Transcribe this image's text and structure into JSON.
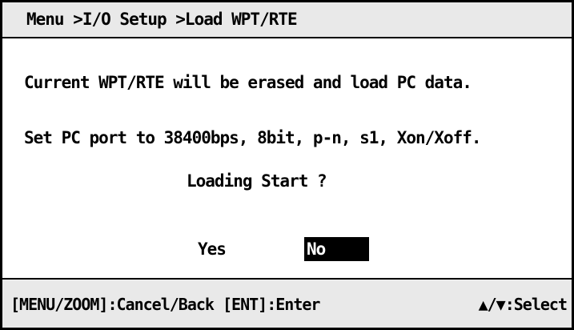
{
  "header": {
    "breadcrumb": "Menu >I/O Setup >Load WPT/RTE"
  },
  "body": {
    "line1": "Current WPT/RTE will be erased and load PC data.",
    "line2": "Set PC port to 38400bps, 8bit, p-n, s1, Xon/Xoff.",
    "prompt": "Loading Start ?"
  },
  "options": {
    "yes": "Yes",
    "no": "No",
    "selected": "No"
  },
  "footer": {
    "left": "[MENU/ZOOM]:Cancel/Back [ENT]:Enter",
    "right": "▲/▼:Select"
  },
  "colors": {
    "background": "#ffffff",
    "bar": "#e9e9e9",
    "text": "#000000",
    "highlight": "#000000",
    "highlight_text": "#ffffff"
  }
}
